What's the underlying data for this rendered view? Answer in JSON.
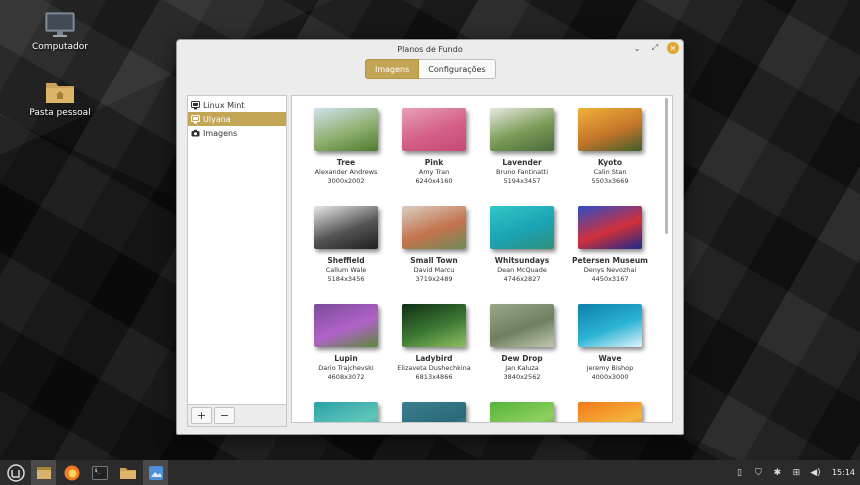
{
  "desktop": {
    "icons": [
      {
        "label": "Computador",
        "icon": "monitor-icon"
      },
      {
        "label": "Pasta pessoal",
        "icon": "folder-home-icon"
      }
    ]
  },
  "window": {
    "title": "Planos de Fundo",
    "tabs": [
      {
        "label": "Imagens",
        "active": true
      },
      {
        "label": "Configurações",
        "active": false
      }
    ],
    "sidebar": {
      "items": [
        {
          "label": "Linux Mint",
          "icon": "monitor-small-icon",
          "selected": false
        },
        {
          "label": "Ulyana",
          "icon": "monitor-small-icon",
          "selected": true
        },
        {
          "label": "Imagens",
          "icon": "camera-icon",
          "selected": false
        }
      ],
      "add_label": "+",
      "remove_label": "−"
    },
    "wallpapers": [
      {
        "name": "Tree",
        "author": "Alexander Andrews",
        "size": "3000x2002",
        "colors": [
          "#cfe2ef",
          "#8fb070",
          "#4d7a2e"
        ]
      },
      {
        "name": "Pink",
        "author": "Amy Tran",
        "size": "6240x4160",
        "colors": [
          "#e8a0b8",
          "#d45f88",
          "#c44a75"
        ]
      },
      {
        "name": "Lavender",
        "author": "Bruno Fantinatti",
        "size": "5194x3457",
        "colors": [
          "#e6e9e0",
          "#7a9a55",
          "#4a6a3a"
        ]
      },
      {
        "name": "Kyoto",
        "author": "Calin Stan",
        "size": "5503x3669",
        "colors": [
          "#f0b13a",
          "#c5762a",
          "#3f5d2d"
        ]
      },
      {
        "name": "Sheffield",
        "author": "Callum Wale",
        "size": "5184x3456",
        "colors": [
          "#e8e8e8",
          "#555555",
          "#1e1e1e"
        ]
      },
      {
        "name": "Small Town",
        "author": "David Marcu",
        "size": "3719x2489",
        "colors": [
          "#d9cfc3",
          "#c4734d",
          "#6d8a55"
        ]
      },
      {
        "name": "Whitsundays",
        "author": "Dean McQuade",
        "size": "4746x2827",
        "colors": [
          "#31c7c7",
          "#1ba3b3",
          "#2f8f7a"
        ]
      },
      {
        "name": "Petersen Museum",
        "author": "Denys Nevozhai",
        "size": "4450x3167",
        "colors": [
          "#2c4ec7",
          "#d0303a",
          "#1a2a8a"
        ]
      },
      {
        "name": "Lupin",
        "author": "Dario Trajchevski",
        "size": "4608x3072",
        "colors": [
          "#7a4c9a",
          "#b162c8",
          "#5a8a3a"
        ]
      },
      {
        "name": "Ladybird",
        "author": "Elizaveta Dushechkina",
        "size": "6813x4866",
        "colors": [
          "#0f2f14",
          "#3d7a35",
          "#8fc060"
        ]
      },
      {
        "name": "Dew Drop",
        "author": "Jan Kaluza",
        "size": "3840x2562",
        "colors": [
          "#9aa78a",
          "#6f7f60",
          "#c0c9b0"
        ]
      },
      {
        "name": "Wave",
        "author": "Jeremy Bishop",
        "size": "4000x3000",
        "colors": [
          "#0d7fa8",
          "#2bb3d4",
          "#e0f4fa"
        ]
      },
      {
        "name": "",
        "author": "",
        "size": "",
        "colors": [
          "#2aa0a8",
          "#5fc6b8",
          "#1a6f7a"
        ]
      },
      {
        "name": "",
        "author": "",
        "size": "",
        "colors": [
          "#3a7f8f",
          "#2b6a7a",
          "#6fb0b8"
        ]
      },
      {
        "name": "",
        "author": "",
        "size": "",
        "colors": [
          "#55b33a",
          "#8fd060",
          "#2a7a20"
        ]
      },
      {
        "name": "",
        "author": "",
        "size": "",
        "colors": [
          "#f27a1a",
          "#f5b33a",
          "#d03a10"
        ]
      }
    ]
  },
  "taskbar": {
    "apps": [
      {
        "icon": "mint-menu-icon",
        "active": false
      },
      {
        "icon": "show-desktop-icon",
        "active": true
      },
      {
        "icon": "firefox-icon",
        "active": false
      },
      {
        "icon": "terminal-icon",
        "active": false
      },
      {
        "icon": "files-icon",
        "active": false
      },
      {
        "icon": "wallpaper-settings-icon",
        "active": true
      }
    ],
    "tray_icons": [
      "clipboard-icon",
      "shield-icon",
      "bluetooth-icon",
      "network-icon",
      "volume-icon"
    ],
    "clock": "15:14"
  },
  "colors": {
    "accent": "#c3a556"
  }
}
